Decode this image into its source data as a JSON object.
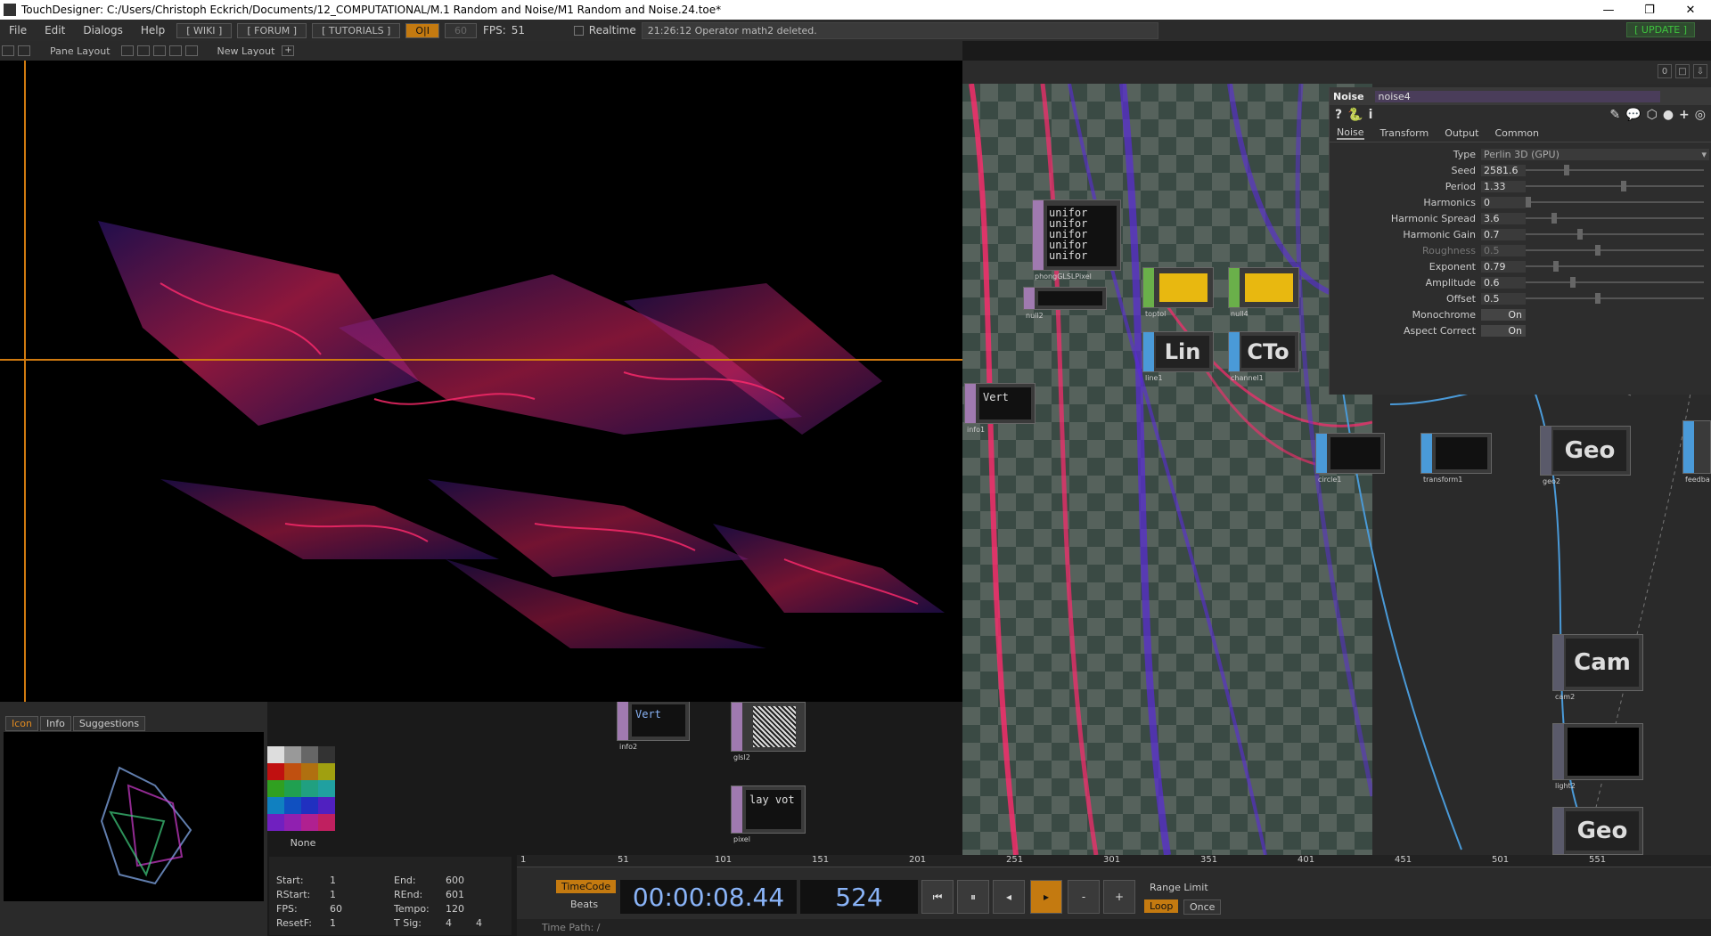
{
  "window": {
    "title": "TouchDesigner: C:/Users/Christoph Eckrich/Documents/12_COMPUTATIONAL/M.1 Random and Noise/M1 Random and Noise.24.toe*"
  },
  "menu": {
    "items": [
      "File",
      "Edit",
      "Dialogs",
      "Help"
    ],
    "wiki": "[ WIKI ]",
    "forum": "[ FORUM ]",
    "tutorials": "[ TUTORIALS ]",
    "oi": "O|I",
    "fps_target": "60",
    "fps_label": "FPS:",
    "fps_value": "51",
    "realtime": "Realtime",
    "status": "21:26:12 Operator math2 deleted.",
    "update": "[ UPDATE ]"
  },
  "panebar": {
    "pane_layout": "Pane Layout",
    "new_layout": "New Layout",
    "plus": "+"
  },
  "topright": {
    "counter": "0"
  },
  "network_nodes": {
    "phong": "phongGLSLPixel",
    "phong_code": [
      "unifor",
      "unifor",
      "unifor",
      "unifor",
      "unifor"
    ],
    "null2": "null2",
    "toptol": "toptol",
    "null4": "null4",
    "line1": "line1",
    "line1_text": "Lin",
    "channel1": "channel1",
    "channel1_text": "CTo",
    "info1": "info1",
    "info1_code": "Vert",
    "circle1": "circle1",
    "transform1": "transform1",
    "geo2": "geo2",
    "geo_text": "Geo",
    "feedback": "feedba",
    "cam2": "cam2",
    "cam_text": "Cam",
    "light2": "light2",
    "info2": "info2",
    "info2_code": "Vert",
    "glsl2": "glsl2",
    "pixel": "pixel",
    "pixel_code": "lay vot"
  },
  "params": {
    "op_type": "Noise",
    "op_name": "noise4",
    "tabs": [
      "Noise",
      "Transform",
      "Output",
      "Common"
    ],
    "type_label": "Type",
    "type_value": "Perlin 3D (GPU)",
    "rows": [
      {
        "label": "Seed",
        "value": "2581.6",
        "pos": 0.22
      },
      {
        "label": "Period",
        "value": "1.33",
        "pos": 0.55
      },
      {
        "label": "Harmonics",
        "value": "0",
        "pos": 0.0
      },
      {
        "label": "Harmonic Spread",
        "value": "3.6",
        "pos": 0.15
      },
      {
        "label": "Harmonic Gain",
        "value": "0.7",
        "pos": 0.3
      },
      {
        "label": "Roughness",
        "value": "0.5",
        "pos": 0.4,
        "disabled": true
      },
      {
        "label": "Exponent",
        "value": "0.79",
        "pos": 0.16
      },
      {
        "label": "Amplitude",
        "value": "0.6",
        "pos": 0.26
      },
      {
        "label": "Offset",
        "value": "0.5",
        "pos": 0.4
      }
    ],
    "monochrome_label": "Monochrome",
    "monochrome_value": "On",
    "aspect_label": "Aspect Correct",
    "aspect_value": "On"
  },
  "bottomleft": {
    "tabs": [
      "Icon",
      "Info",
      "Suggestions"
    ],
    "palette_none": "None"
  },
  "timeinfo": {
    "start_label": "Start:",
    "start": "1",
    "end_label": "End:",
    "end": "600",
    "rstart_label": "RStart:",
    "rstart": "1",
    "rend_label": "REnd:",
    "rend": "601",
    "fps_label": "FPS:",
    "fps": "60",
    "tempo_label": "Tempo:",
    "tempo": "120",
    "resetf_label": "ResetF:",
    "resetf": "1",
    "tsig_label": "T Sig:",
    "tsig1": "4",
    "tsig2": "4"
  },
  "ruler": [
    "1",
    "51",
    "101",
    "151",
    "201",
    "251",
    "301",
    "351",
    "401",
    "451",
    "501",
    "551"
  ],
  "timeline": {
    "timecode": "TimeCode",
    "beats": "Beats",
    "clock": "00:00:08.44",
    "frame": "524",
    "range_limit": "Range Limit",
    "loop": "Loop",
    "once": "Once",
    "time_path": "Time Path: /"
  },
  "colors": {
    "accent": "#d07a10",
    "purple_noise": "#5a2bd8",
    "pink_noise": "#ff2a6d"
  }
}
